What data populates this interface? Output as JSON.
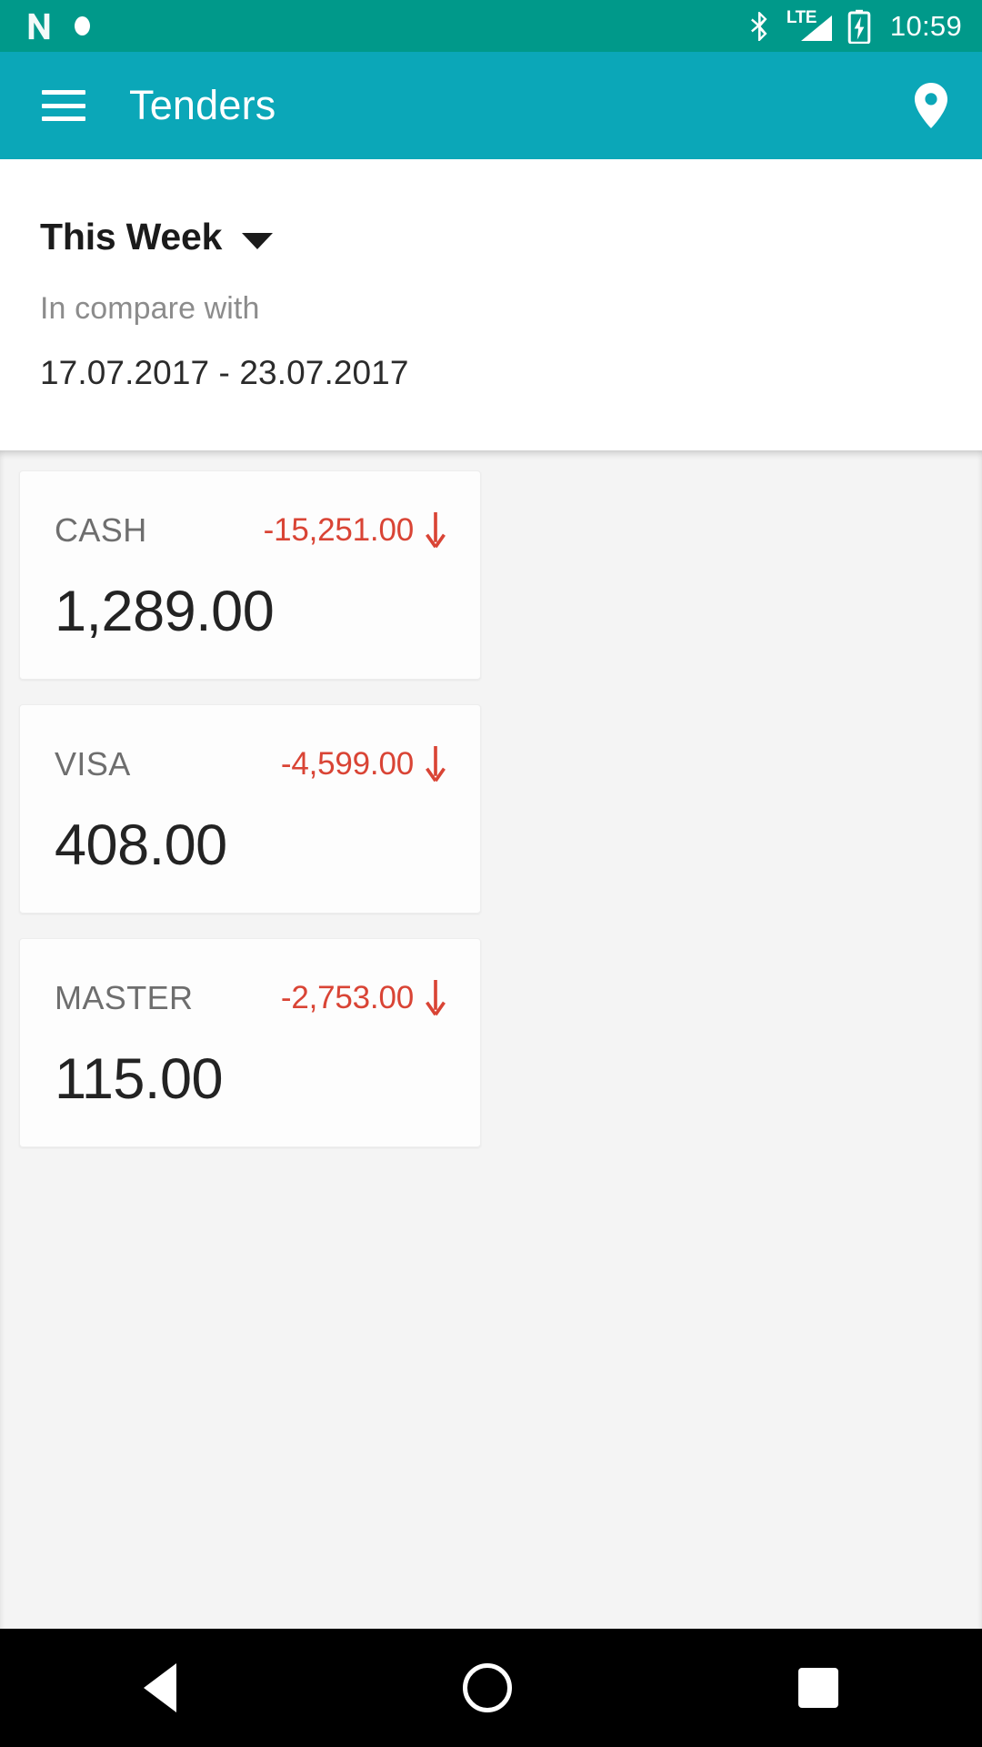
{
  "status_bar": {
    "icons": [
      "n-logo-icon",
      "dot-icon",
      "bluetooth-icon",
      "lte-signal-icon",
      "battery-charging-icon"
    ],
    "network_label": "LTE",
    "clock": "10:59",
    "background_color": "#00998a"
  },
  "app_bar": {
    "menu_icon": "hamburger-menu-icon",
    "title": "Tenders",
    "action_icon": "location-pin-icon",
    "background_color": "#0ba7b8"
  },
  "filter": {
    "period": "This Week",
    "caret_icon": "chevron-down-icon",
    "compare_label": "In compare with",
    "date_range": "17.07.2017 - 23.07.2017"
  },
  "cards": [
    {
      "name": "CASH",
      "delta": "-15,251.00",
      "trend_icon": "arrow-down-icon",
      "trend_color": "#d94435",
      "value": "1,289.00"
    },
    {
      "name": "VISA",
      "delta": "-4,599.00",
      "trend_icon": "arrow-down-icon",
      "trend_color": "#d94435",
      "value": "408.00"
    },
    {
      "name": "MASTER",
      "delta": "-2,753.00",
      "trend_icon": "arrow-down-icon",
      "trend_color": "#d94435",
      "value": "115.00"
    }
  ],
  "nav_bar": {
    "back": "back-triangle-icon",
    "home": "home-circle-icon",
    "recents": "recents-square-icon"
  }
}
